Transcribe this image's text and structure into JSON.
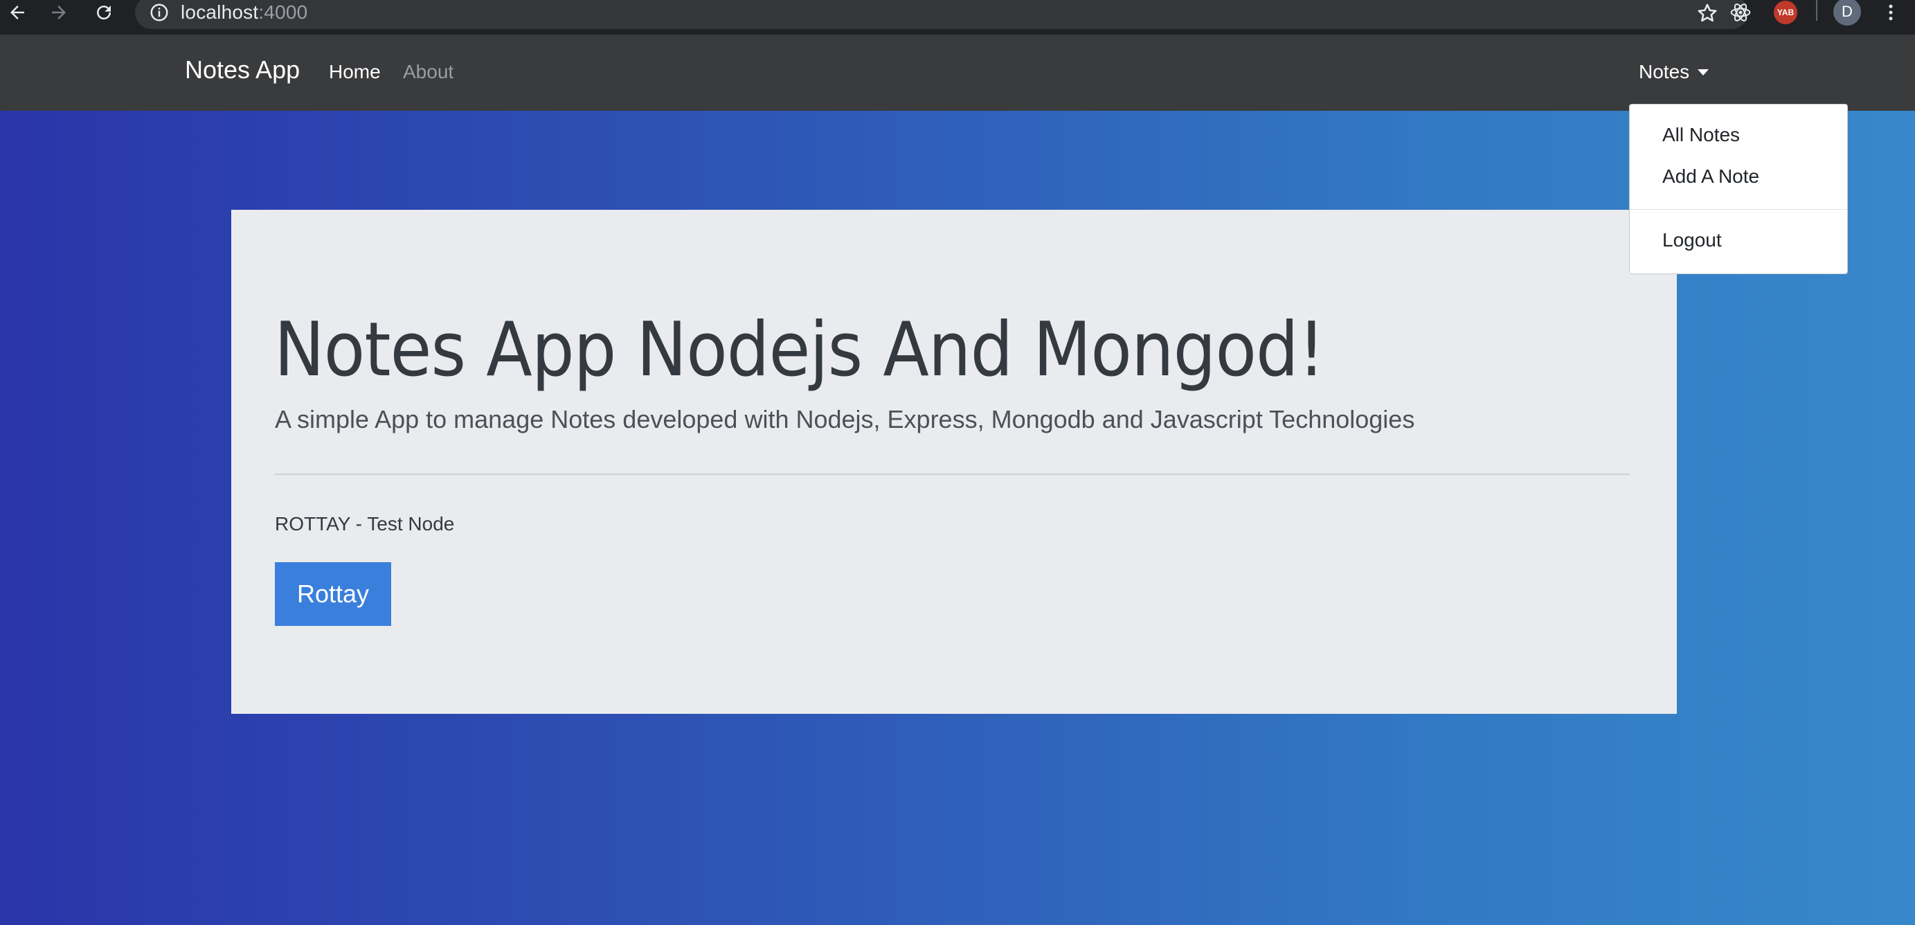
{
  "browser": {
    "url_host": "localhost",
    "url_port": ":4000",
    "avatar_initial": "D",
    "extension_badge": "YAB"
  },
  "navbar": {
    "brand": "Notes App",
    "links": [
      "Home",
      "About"
    ],
    "dropdown_toggle": "Notes"
  },
  "dropdown": {
    "items": [
      "All Notes",
      "Add A Note"
    ],
    "logout": "Logout"
  },
  "hero": {
    "title": "Notes App Nodejs And Mongod!",
    "lead": "A simple App to manage Notes developed with Nodejs, Express, Mongodb and Javascript Technologies",
    "subtext": "ROTTAY - Test Node",
    "button": "Rottay"
  },
  "colors": {
    "navbar": "#3a3b3d",
    "primary_button": "#3a7fdc",
    "gradient_start": "#2a35a9",
    "gradient_end": "#3788ca",
    "jumbotron": "#e9ebee"
  }
}
